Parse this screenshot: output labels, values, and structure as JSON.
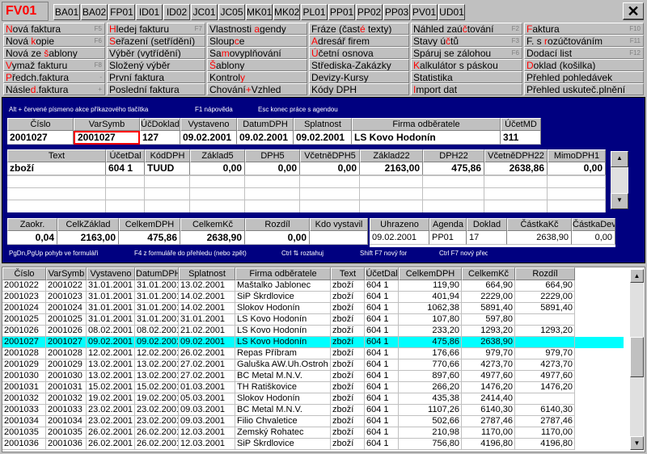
{
  "app_id": "FV01",
  "tabs": [
    "BA01",
    "BA02",
    "FP01",
    "ID01",
    "ID02",
    "JC01",
    "JC05",
    "MK01",
    "MK02",
    "PL01",
    "PP01",
    "PP02",
    "PP03",
    "PV01",
    "UD01"
  ],
  "close_label": "✕",
  "menu": [
    [
      {
        "pre": "",
        "key": "N",
        "post": "ová faktura",
        "sc": "F5"
      },
      {
        "pre": "",
        "key": "H",
        "post": "ledej fakturu",
        "sc": "F7"
      },
      {
        "pre": "Vlastnosti ",
        "key": "a",
        "post": "gendy",
        "sc": ""
      },
      {
        "pre": "Fráze (čast",
        "key": "é",
        "post": " texty)",
        "sc": ""
      },
      {
        "pre": "Náhled zaú",
        "key": "č",
        "post": "tování",
        "sc": "F2"
      },
      {
        "pre": "",
        "key": "F",
        "post": "aktura",
        "sc": "F10"
      }
    ],
    [
      {
        "pre": "Nová ",
        "key": "k",
        "post": "opie",
        "sc": "F6"
      },
      {
        "pre": "",
        "key": "S",
        "post": "eřazení (setřídění)",
        "sc": ""
      },
      {
        "pre": "Sloup",
        "key": "c",
        "post": "e",
        "sc": ""
      },
      {
        "pre": "",
        "key": "A",
        "post": "dresář firem",
        "sc": ""
      },
      {
        "pre": "Stavy ú",
        "key": "č",
        "post": "tů",
        "sc": "F3"
      },
      {
        "pre": "F. s ",
        "key": "r",
        "post": "ozúčtováním",
        "sc": "F11"
      }
    ],
    [
      {
        "pre": "Nová ze ",
        "key": "š",
        "post": "ablony",
        "sc": ""
      },
      {
        "pre": "Výběr (vytřídění)",
        "key": "",
        "post": "",
        "sc": ""
      },
      {
        "pre": "Sa",
        "key": "m",
        "post": "ovyplňování",
        "sc": ""
      },
      {
        "pre": "",
        "key": "Ú",
        "post": "četní osnova",
        "sc": ""
      },
      {
        "pre": "Spáruj se zálohou",
        "key": "",
        "post": "",
        "sc": "F6"
      },
      {
        "pre": "Dodací list",
        "key": "",
        "post": "",
        "sc": "F12"
      }
    ],
    [
      {
        "pre": "",
        "key": "V",
        "post": "ymaž fakturu",
        "sc": "F8"
      },
      {
        "pre": "Složený výběr",
        "key": "",
        "post": "",
        "sc": ""
      },
      {
        "pre": "",
        "key": "Š",
        "post": "ablony",
        "sc": ""
      },
      {
        "pre": "Střediska-Zakázky",
        "key": "",
        "post": "",
        "sc": ""
      },
      {
        "pre": "",
        "key": "K",
        "post": "alkulátor s páskou",
        "sc": ""
      },
      {
        "pre": "",
        "key": "D",
        "post": "oklad (košilka)",
        "sc": ""
      }
    ],
    [
      {
        "pre": "",
        "key": "P",
        "post": "ředch.faktura",
        "sc": "-"
      },
      {
        "pre": "První faktura",
        "key": "",
        "post": "",
        "sc": ""
      },
      {
        "pre": "Kontrol",
        "key": "y",
        "post": "",
        "sc": ""
      },
      {
        "pre": "Devizy-Kursy",
        "key": "",
        "post": "",
        "sc": ""
      },
      {
        "pre": "Statistika",
        "key": "",
        "post": "",
        "sc": ""
      },
      {
        "pre": "Přehled pohledávek",
        "key": "",
        "post": "",
        "sc": ""
      }
    ],
    [
      {
        "pre": "Násle",
        "key": "d",
        "post": ".faktura",
        "sc": "+"
      },
      {
        "pre": "Poslední faktura",
        "key": "",
        "post": "",
        "sc": ""
      },
      {
        "pre": "Chování",
        "key": "+",
        "post": "Vzhled",
        "sc": ""
      },
      {
        "pre": "Kódy DPH",
        "key": "",
        "post": "",
        "sc": ""
      },
      {
        "pre": "",
        "key": "I",
        "post": "mport dat",
        "sc": ""
      },
      {
        "pre": "Přehled uskuteč.plnění",
        "key": "",
        "post": "",
        "sc": ""
      }
    ]
  ],
  "hints_top": [
    "Alt + červené písmeno akce příkazového tlačítka",
    "F1 nápověda",
    "Esc konec práce s agendou"
  ],
  "hints_bottom": [
    "PgDn,PgUp pohyb ve formuláři",
    "F4 z formuláře do přehledu (nebo zpět)",
    "Ctrl ⇅ roztahuj",
    "Shift F7 nový formulář",
    "Ctrl F7 nový předkontace"
  ],
  "header": {
    "labels": [
      "Číslo",
      "VarSymb",
      "ÚčDoklad",
      "Vystaveno",
      "DatumDPH",
      "Splatnost",
      "Firma odběratele",
      "ÚčetMD"
    ],
    "values": [
      "2001027",
      "2001027",
      "127",
      "09.02.2001",
      "09.02.2001",
      "09.02.2001",
      "LS Kovo Hodonín",
      "311"
    ]
  },
  "items": {
    "labels": [
      "Text",
      "ÚčetDal",
      "KódDPH",
      "Základ5",
      "DPH5",
      "VčetněDPH5",
      "Základ22",
      "DPH22",
      "VčetněDPH22",
      "MimoDPH1"
    ],
    "rows": [
      [
        "zboží",
        "604 1",
        "TUUD",
        "0,00",
        "0,00",
        "0,00",
        "2163,00",
        "475,86",
        "2638,86",
        "0,00"
      ]
    ]
  },
  "totals": {
    "labels": [
      "Zaokr.",
      "CelkZáklad",
      "CelkemDPH",
      "CelkemKč",
      "Rozdíl",
      "Kdo vystavil"
    ],
    "values": [
      "0,04",
      "2163,00",
      "475,86",
      "2638,90",
      "0,00",
      ""
    ]
  },
  "payments": {
    "labels": [
      "Uhrazeno",
      "Agenda",
      "Doklad",
      "ČástkaKč",
      "ČástkaDeviz"
    ],
    "rows": [
      [
        "09.02.2001",
        "PP01",
        "17",
        "2638,90",
        "0,00"
      ]
    ]
  },
  "list": {
    "labels": [
      "Číslo",
      "VarSymb",
      "Vystaveno",
      "DatumDPH",
      "Splatnost",
      "Firma odběratele",
      "Text",
      "ÚčetDal",
      "CelkemDPH",
      "CelkemKč",
      "Rozdíl"
    ],
    "rows": [
      [
        "2001022",
        "2001022",
        "31.01.2001",
        "31.01.2001",
        "13.02.2001",
        "Maštalko Jablonec",
        "zboží",
        "604 1",
        "119,90",
        "664,90",
        "664,90"
      ],
      [
        "2001023",
        "2001023",
        "31.01.2001",
        "31.01.2001",
        "14.02.2001",
        "SiP Škrdlovice",
        "zboží",
        "604 1",
        "401,94",
        "2229,00",
        "2229,00"
      ],
      [
        "2001024",
        "2001024",
        "31.01.2001",
        "31.01.2001",
        "14.02.2001",
        "Slokov Hodonín",
        "zboží",
        "604 1",
        "1062,38",
        "5891,40",
        "5891,40"
      ],
      [
        "2001025",
        "2001025",
        "31.01.2001",
        "31.01.2001",
        "31.01.2001",
        "LS Kovo Hodonín",
        "zboží",
        "604 1",
        "107,80",
        "597,80",
        ""
      ],
      [
        "2001026",
        "2001026",
        "08.02.2001",
        "08.02.2001",
        "21.02.2001",
        "LS Kovo Hodonín",
        "zboží",
        "604 1",
        "233,20",
        "1293,20",
        "1293,20"
      ],
      [
        "2001027",
        "2001027",
        "09.02.2001",
        "09.02.2001",
        "09.02.2001",
        "LS Kovo Hodonín",
        "zboží",
        "604 1",
        "475,86",
        "2638,90",
        ""
      ],
      [
        "2001028",
        "2001028",
        "12.02.2001",
        "12.02.2001",
        "26.02.2001",
        "Repas Příbram",
        "zboží",
        "604 1",
        "176,66",
        "979,70",
        "979,70"
      ],
      [
        "2001029",
        "2001029",
        "13.02.2001",
        "13.02.2001",
        "27.02.2001",
        "Galuška AW.Uh.Ostroh",
        "zboží",
        "604 1",
        "770,66",
        "4273,70",
        "4273,70"
      ],
      [
        "2001030",
        "2001030",
        "13.02.2001",
        "13.02.2001",
        "27.02.2001",
        "BC Metal M.N.V.",
        "zboží",
        "604 1",
        "897,60",
        "4977,60",
        "4977,60"
      ],
      [
        "2001031",
        "2001031",
        "15.02.2001",
        "15.02.2001",
        "01.03.2001",
        "TH Ratiškovice",
        "zboží",
        "604 1",
        "266,20",
        "1476,20",
        "1476,20"
      ],
      [
        "2001032",
        "2001032",
        "19.02.2001",
        "19.02.2001",
        "05.03.2001",
        "Slokov Hodonín",
        "zboží",
        "604 1",
        "435,38",
        "2414,40",
        ""
      ],
      [
        "2001033",
        "2001033",
        "23.02.2001",
        "23.02.2001",
        "09.03.2001",
        "BC Metal M.N.V.",
        "zboží",
        "604 1",
        "1107,26",
        "6140,30",
        "6140,30"
      ],
      [
        "2001034",
        "2001034",
        "23.02.2001",
        "23.02.2001",
        "09.03.2001",
        "Filio Chvaletice",
        "zboží",
        "604 1",
        "502,66",
        "2787,46",
        "2787,46"
      ],
      [
        "2001035",
        "2001035",
        "26.02.2001",
        "26.02.2001",
        "12.03.2001",
        "Zemský Rohatec",
        "zboží",
        "604 1",
        "210,98",
        "1170,00",
        "1170,00"
      ],
      [
        "2001036",
        "2001036",
        "26.02.2001",
        "26.02.2001",
        "12.03.2001",
        "SiP Škrdlovice",
        "zboží",
        "604 1",
        "756,80",
        "4196,80",
        "4196,80"
      ]
    ],
    "selected_index": 5
  }
}
